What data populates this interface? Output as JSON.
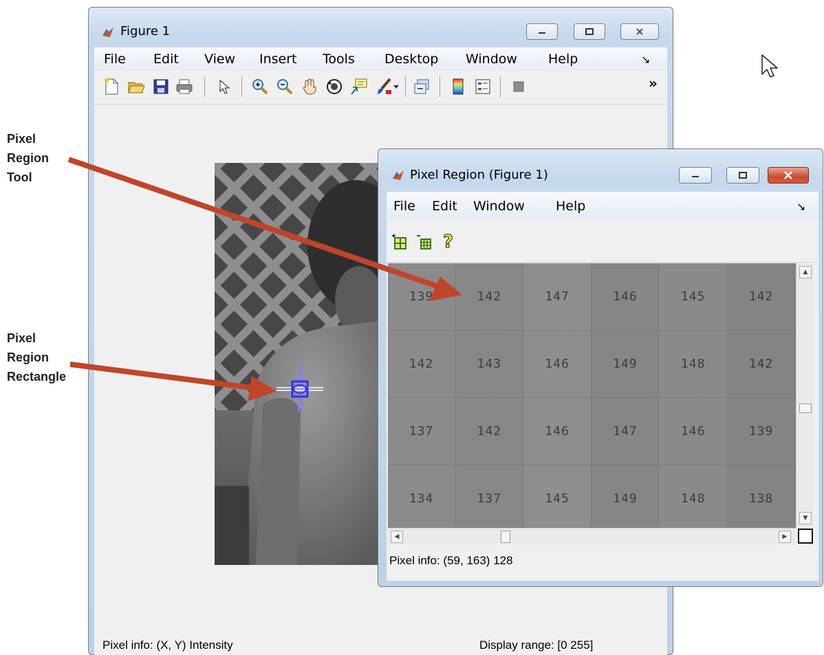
{
  "figure_window": {
    "title": "Figure 1",
    "menu": [
      "File",
      "Edit",
      "View",
      "Insert",
      "Tools",
      "Desktop",
      "Window",
      "Help"
    ],
    "menu_dock_glyph": "↘",
    "toolbar_overflow": "»",
    "toolbar_icons": [
      "new-figure-icon",
      "open-file-icon",
      "save-icon",
      "print-icon",
      "pointer-icon",
      "zoom-in-icon",
      "zoom-out-icon",
      "pan-hand-icon",
      "rotate-3d-icon",
      "data-cursor-icon",
      "brush-icon",
      "dropdown-arrow-icon",
      "link-plot-icon",
      "colorbar-icon",
      "legend-icon",
      "plot-tools-icon"
    ],
    "status_left": "Pixel info: (X, Y)  Intensity",
    "status_right": "Display range: [0 255]"
  },
  "pixel_region_window": {
    "title": "Pixel Region (Figure 1)",
    "menu": [
      "File",
      "Edit",
      "Window",
      "Help"
    ],
    "menu_dock_glyph": "↘",
    "toolbar_icons": [
      "expand-grid-icon",
      "shrink-grid-icon",
      "help-icon"
    ],
    "grid_values": [
      [
        "139",
        "142",
        "147",
        "146",
        "145",
        "142"
      ],
      [
        "142",
        "143",
        "146",
        "149",
        "148",
        "142"
      ],
      [
        "137",
        "142",
        "146",
        "147",
        "146",
        "139"
      ],
      [
        "134",
        "137",
        "145",
        "149",
        "148",
        "138"
      ]
    ],
    "status": "Pixel info: (59, 163)  128"
  },
  "annotations": {
    "tool_label": "Pixel\nRegion\nTool",
    "rectangle_label": "Pixel\nRegion\nRectangle",
    "arrow_color": "#c0452a"
  },
  "colors": {
    "title_bar": "#c6d9ec",
    "close_button_red": "#c94a30",
    "grid_background": "#8a8a8a",
    "roi_marker": "#2f2fff"
  }
}
